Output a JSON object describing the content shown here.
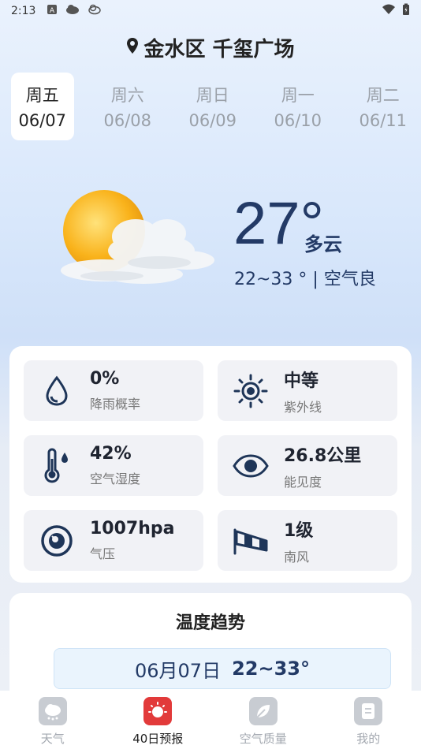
{
  "status": {
    "time": "2:13"
  },
  "location": {
    "name": "金水区 千玺广场"
  },
  "days": [
    {
      "dow": "周五",
      "date": "06/07",
      "active": true
    },
    {
      "dow": "周六",
      "date": "06/08",
      "active": false
    },
    {
      "dow": "周日",
      "date": "06/09",
      "active": false
    },
    {
      "dow": "周一",
      "date": "06/10",
      "active": false
    },
    {
      "dow": "周二",
      "date": "06/11",
      "active": false
    }
  ],
  "current": {
    "temp": "27°",
    "condition": "多云",
    "range": "22~33 ° | 空气良"
  },
  "details": [
    {
      "value": "0%",
      "label": "降雨概率",
      "icon": "raindrop-icon"
    },
    {
      "value": "中等",
      "label": "紫外线",
      "icon": "sun-icon"
    },
    {
      "value": "42%",
      "label": "空气湿度",
      "icon": "thermometer-icon"
    },
    {
      "value": "26.8公里",
      "label": "能见度",
      "icon": "eye-icon"
    },
    {
      "value": "1007hpa",
      "label": "气压",
      "icon": "pressure-icon"
    },
    {
      "value": "1级",
      "label": "南风",
      "icon": "windsock-icon"
    }
  ],
  "trend": {
    "title": "温度趋势",
    "date": "06月07日",
    "range": "22~33°"
  },
  "nav": [
    {
      "label": "天气",
      "icon": "weather-nav-icon",
      "active": false
    },
    {
      "label": "40日预报",
      "icon": "forecast-nav-icon",
      "active": true
    },
    {
      "label": "空气质量",
      "icon": "air-quality-nav-icon",
      "active": false
    },
    {
      "label": "我的",
      "icon": "profile-nav-icon",
      "active": false
    }
  ],
  "colors": {
    "accent": "#233a66",
    "nav_active": "#e23a3a",
    "tile_bg": "#f1f2f6"
  }
}
